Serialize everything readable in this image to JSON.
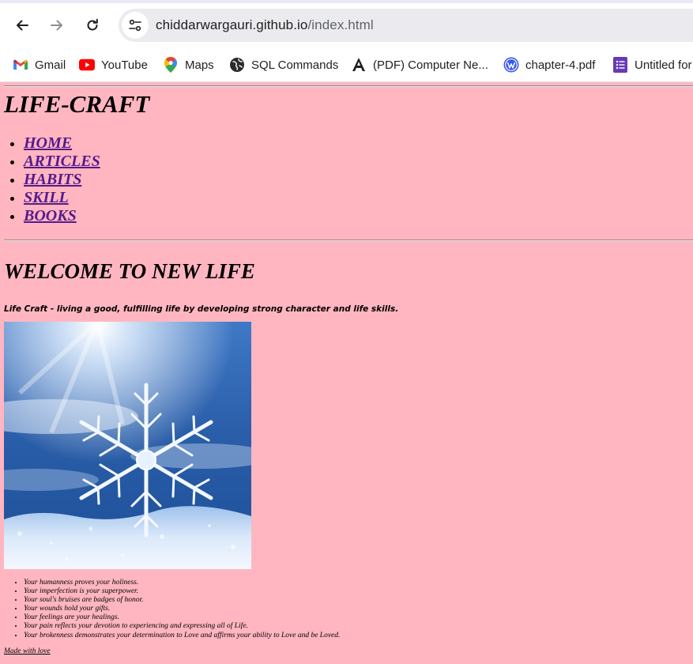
{
  "browser": {
    "url_domain": "chiddarwargauri.github.io",
    "url_path": "/index.html",
    "bookmarks": [
      {
        "label": "Gmail",
        "icon": "gmail-icon"
      },
      {
        "label": "YouTube",
        "icon": "youtube-icon"
      },
      {
        "label": "Maps",
        "icon": "maps-icon"
      },
      {
        "label": "SQL Commands",
        "icon": "globe-icon"
      },
      {
        "label": "(PDF) Computer Ne...",
        "icon": "academia-icon"
      },
      {
        "label": "chapter-4.pdf",
        "icon": "wordpress-icon"
      },
      {
        "label": "Untitled for",
        "icon": "forms-icon"
      }
    ]
  },
  "page": {
    "background": "#ffb6c1",
    "link_color": "#551a8b",
    "site_title": "LIFE-CRAFT",
    "nav": [
      "HOME",
      "ARTICLES",
      "HABITS",
      "SKILL",
      "BOOKS"
    ],
    "welcome_heading": "WELCOME TO NEW LIFE",
    "tagline": "Life Craft - living a good, fulfilling life by developing strong character and life skills.",
    "hero_image": "snowflake-image",
    "quotes": [
      "Your humanness proves your holiness.",
      "Your imperfection is your superpower.",
      "Your soul's bruises are badges of honor.",
      "Your wounds hold your gifts.",
      "Your feelings are your healings.",
      "Your pain reflects your devotion to experiencing and expressing all of Life.",
      "Your brokenness demonstrates your determination to Love and affirms your ability to Love and be Loved."
    ],
    "footer_link": "Made with love"
  }
}
